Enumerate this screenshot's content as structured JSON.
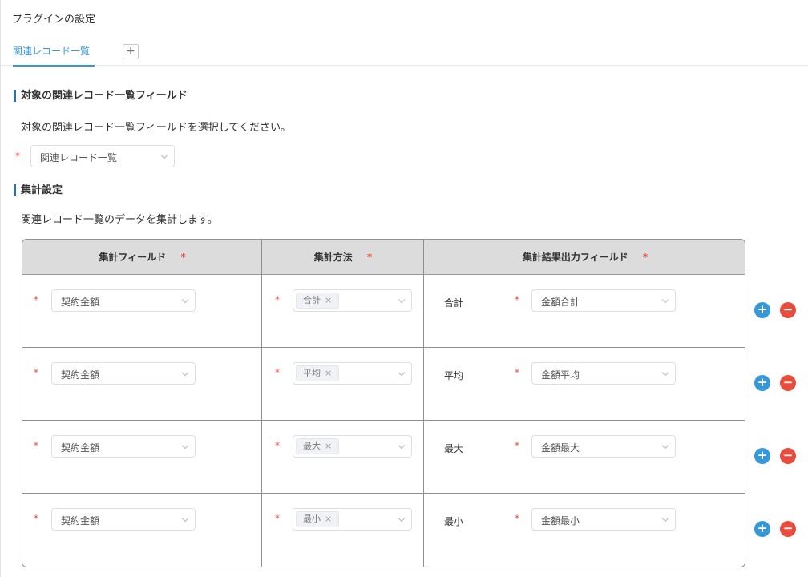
{
  "header": {
    "title": "プラグインの設定"
  },
  "tabs": [
    {
      "label": "関連レコード一覧"
    }
  ],
  "tab_add_label": "+",
  "section1": {
    "title": "対象の関連レコード一覧フィールド",
    "description": "対象の関連レコード一覧フィールドを選択してください。",
    "required_mark": "*",
    "select_value": "関連レコード一覧"
  },
  "section2": {
    "title": "集計設定",
    "description": "関連レコード一覧のデータを集計します。"
  },
  "table": {
    "headers": {
      "field": "集計フィールド",
      "method": "集計方法",
      "output": "集計結果出力フィールド"
    },
    "required_mark": "*",
    "rows": [
      {
        "field": "契約金額",
        "method_tag": "合計",
        "method_label": "合計",
        "output": "金額合計"
      },
      {
        "field": "契約金額",
        "method_tag": "平均",
        "method_label": "平均",
        "output": "金額平均"
      },
      {
        "field": "契約金額",
        "method_tag": "最大",
        "method_label": "最大",
        "output": "金額最大"
      },
      {
        "field": "契約金額",
        "method_tag": "最小",
        "method_label": "最小",
        "output": "金額最小"
      }
    ]
  },
  "buttons": {
    "add": "+",
    "remove": "−",
    "tag_remove": "×"
  },
  "colors": {
    "accent": "#3498db",
    "danger": "#e74c3c",
    "section_bar": "#2e6f9e",
    "table_header": "#dcdcdc"
  }
}
